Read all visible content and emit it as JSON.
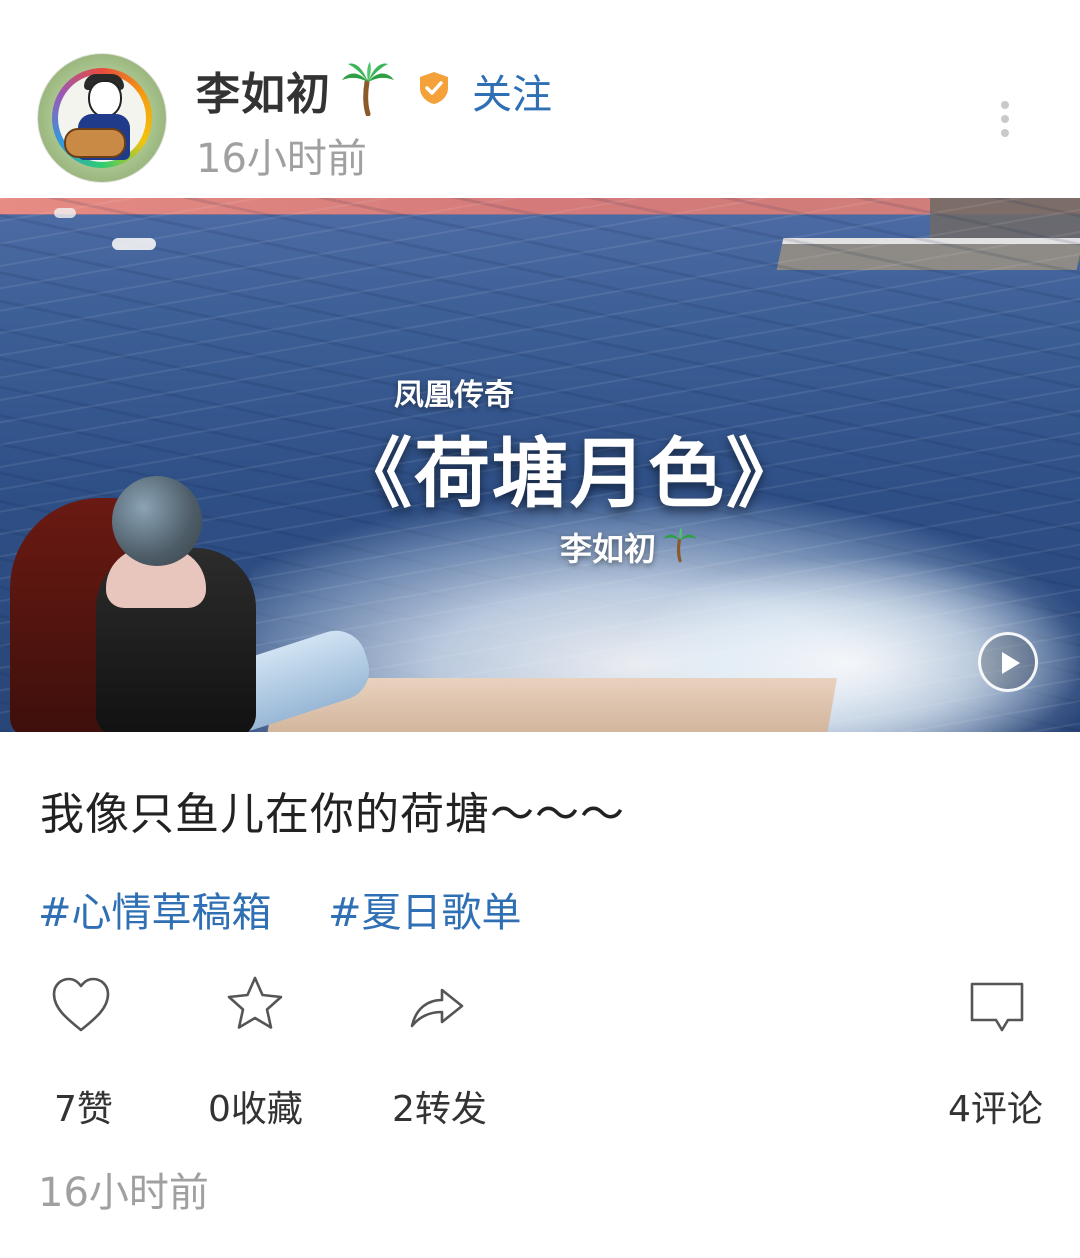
{
  "header": {
    "author_name": "李如初",
    "follow_label": "关注",
    "post_time": "16小时前"
  },
  "icons": {
    "author_emoji": "palm-tree-icon",
    "verified": "verified-badge-icon",
    "more": "more-vertical-icon",
    "play": "play-icon",
    "like": "heart-outline-icon",
    "favorite": "star-outline-icon",
    "share": "share-icon",
    "comment": "comment-icon"
  },
  "video": {
    "subtitle": "凤凰传奇",
    "title": "《荷塘月色》",
    "artist": "李如初"
  },
  "post": {
    "caption": "我像只鱼儿在你的荷塘～～～",
    "tags": [
      "#心情草稿箱",
      "#夏日歌单"
    ]
  },
  "actions": {
    "like_label": "7赞",
    "favorite_label": "0收藏",
    "share_label": "2转发",
    "comment_label": "4评论"
  },
  "footer": {
    "timestamp": "16小时前"
  },
  "colors": {
    "accent_blue": "#2f6fb3",
    "verified_orange": "#f5a13a",
    "muted_text": "#a0a0a0",
    "primary_text": "#222222"
  }
}
